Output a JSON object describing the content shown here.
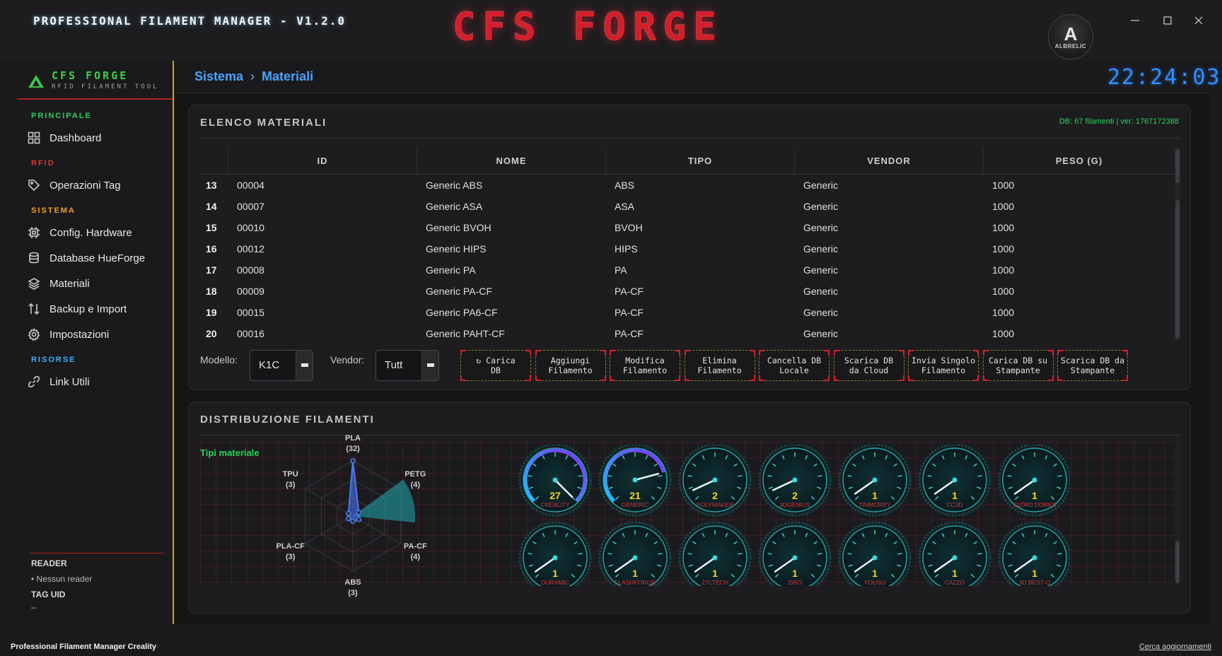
{
  "window": {
    "app_title": "PROFESSIONAL FILAMENT MANAGER - V1.2.0",
    "brand": "CFS FORGE",
    "avatar_label": "ALBRELIC",
    "avatar_mark": "A"
  },
  "sidebar": {
    "logo_name": "CFS FORGE",
    "logo_sub": "RFID FILAMENT TOOL",
    "sections": [
      {
        "label": "PRINCIPALE",
        "color": "#2ed158"
      },
      {
        "label": "RFID",
        "color": "#e0352f"
      },
      {
        "label": "SISTEMA",
        "color": "#f0a020"
      },
      {
        "label": "RISORSE",
        "color": "#3ab0ff"
      }
    ],
    "items": [
      {
        "label": "Dashboard",
        "icon": "dashboard-icon"
      },
      {
        "label": "Operazioni Tag",
        "icon": "tag-icon"
      },
      {
        "label": "Config. Hardware",
        "icon": "chip-icon"
      },
      {
        "label": "Database HueForge",
        "icon": "database-icon"
      },
      {
        "label": "Materiali",
        "icon": "layers-icon"
      },
      {
        "label": "Backup e Import",
        "icon": "transfer-icon"
      },
      {
        "label": "Impostazioni",
        "icon": "gear-icon"
      },
      {
        "label": "Link Utili",
        "icon": "link-icon"
      }
    ],
    "reader": {
      "title": "READER",
      "value": "• Nessun reader",
      "tag_title": "TAG UID",
      "tag_value": "–"
    }
  },
  "header": {
    "breadcrumb": [
      "Sistema",
      "Materiali"
    ],
    "breadcrumb_sep": "›",
    "clock": "22:24:03"
  },
  "materials": {
    "title": "ELENCO MATERIALI",
    "db_info": "DB: 67 filamenti  |  ver: 1767172388",
    "columns": [
      "ID",
      "NOME",
      "TIPO",
      "VENDOR",
      "PESO (G)"
    ],
    "rows": [
      {
        "num": "13",
        "id": "00004",
        "name": "Generic ABS",
        "type": "ABS",
        "vendor": "Generic",
        "weight": "1000"
      },
      {
        "num": "14",
        "id": "00007",
        "name": "Generic ASA",
        "type": "ASA",
        "vendor": "Generic",
        "weight": "1000"
      },
      {
        "num": "15",
        "id": "00010",
        "name": "Generic BVOH",
        "type": "BVOH",
        "vendor": "Generic",
        "weight": "1000"
      },
      {
        "num": "16",
        "id": "00012",
        "name": "Generic HIPS",
        "type": "HIPS",
        "vendor": "Generic",
        "weight": "1000"
      },
      {
        "num": "17",
        "id": "00008",
        "name": "Generic PA",
        "type": "PA",
        "vendor": "Generic",
        "weight": "1000"
      },
      {
        "num": "18",
        "id": "00009",
        "name": "Generic PA-CF",
        "type": "PA-CF",
        "vendor": "Generic",
        "weight": "1000"
      },
      {
        "num": "19",
        "id": "00015",
        "name": "Generic PA6-CF",
        "type": "PA-CF",
        "vendor": "Generic",
        "weight": "1000"
      },
      {
        "num": "20",
        "id": "00016",
        "name": "Generic PAHT-CF",
        "type": "PA-CF",
        "vendor": "Generic",
        "weight": "1000"
      }
    ],
    "model_label": "Modello:",
    "model_value": "K1C",
    "vendor_label": "Vendor:",
    "vendor_value": "Tutt",
    "buttons": [
      "↻ Carica\nDB",
      "Aggiungi\nFilamento",
      "Modifica\nFilamento",
      "Elimina\nFilamento",
      "Cancella DB\nLocale",
      "Scarica DB\nda Cloud",
      "Invia Singolo\nFilamento",
      "Carica DB su\nStampante",
      "Scarica DB da\nStampante"
    ]
  },
  "distribution": {
    "title": "DISTRIBUZIONE FILAMENTI",
    "types_title": "Tipi materiale",
    "radar_labels": [
      {
        "name": "PLA",
        "count": "(32)"
      },
      {
        "name": "PETG",
        "count": "(4)"
      },
      {
        "name": "PA-CF",
        "count": "(4)"
      },
      {
        "name": "ABS",
        "count": "(3)"
      },
      {
        "name": "PLA-CF",
        "count": "(3)"
      },
      {
        "name": "TPU",
        "count": "(3)"
      }
    ],
    "gauges": [
      {
        "value": "27",
        "vendor": "CREALITY"
      },
      {
        "value": "21",
        "vendor": "GENERIC"
      },
      {
        "value": "2",
        "vendor": "POLYMAKER"
      },
      {
        "value": "2",
        "vendor": "3DGENIUS"
      },
      {
        "value": "1",
        "vendor": "TINMORRY"
      },
      {
        "value": "1",
        "vendor": "CC3D"
      },
      {
        "value": "1",
        "vendor": "GIZMO DORKS"
      },
      {
        "value": "1",
        "vendor": "DURAMIC"
      },
      {
        "value": "1",
        "vendor": "FLASHFORGE"
      },
      {
        "value": "1",
        "vendor": "ZYLTECH"
      },
      {
        "value": "1",
        "vendor": "ZIRO"
      },
      {
        "value": "1",
        "vendor": "YOUSU"
      },
      {
        "value": "1",
        "vendor": "CAZZO"
      },
      {
        "value": "1",
        "vendor": "3D BEST-Q"
      }
    ]
  },
  "chart_data": {
    "type": "radar",
    "categories": [
      "PLA",
      "PETG",
      "PA-CF",
      "ABS",
      "PLA-CF",
      "TPU"
    ],
    "values": [
      32,
      4,
      4,
      3,
      3,
      3
    ]
  },
  "statusbar": {
    "left": "Professional Filament Manager Creality",
    "right": "Cerca aggiornamenti"
  }
}
